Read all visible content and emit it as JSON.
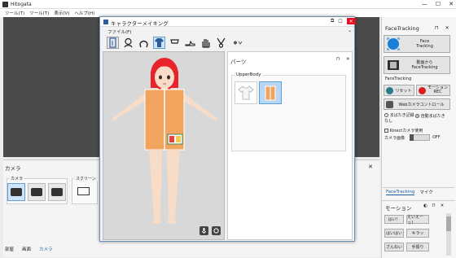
{
  "app": {
    "title": "Hitogata"
  },
  "window_controls": [
    "—",
    "☐",
    "✕"
  ],
  "menu": [
    "ツール(T)",
    "ツール(T)",
    "表示(V)",
    "ヘルプ(H)"
  ],
  "camera_panel": {
    "title": "カメラ",
    "close": "✕",
    "camera_group_label": "カメラ",
    "screen_group_label": "スクリーン",
    "tabs": [
      "部屋",
      "画面",
      "カメラ"
    ],
    "active_tab": "カメラ"
  },
  "dialog": {
    "title": "キャラクターメイキング",
    "controls": [
      "⧉",
      "☐"
    ],
    "close": "✕",
    "menu_label": "ファイル(F)",
    "chevron": "⌄",
    "toolbar_tools": [
      "body-icon",
      "head-icon",
      "hair-icon",
      "upper-body-icon",
      "lower-body-icon",
      "shoes-icon",
      "hand-icon",
      "accessory-icon",
      "more-icon"
    ],
    "active_tool": "upper-body-icon"
  },
  "parts_panel": {
    "title": "パーツ",
    "controls": "⊓ ✕",
    "group_label": "UpperBody",
    "items": [
      {
        "name": "white-shirt",
        "selected": false
      },
      {
        "name": "orange-top",
        "selected": true
      }
    ]
  },
  "face_tracking": {
    "title": "FaceTracking",
    "controls": "⊓ ✕",
    "face_tracking_button": "Face\nTracking",
    "video_button": "動画から\nFaceTracking",
    "section_label": "FaceTracking",
    "reset_button": "リセット",
    "motion_rec_button": "モーション\nREC",
    "webcam_control_button": "Webカメラコントロール",
    "radio_options": [
      {
        "label": "まばたき記録なし",
        "checked": false
      },
      {
        "label": "自動まばたき",
        "checked": true
      }
    ],
    "kinect_checkbox": "Kinectカメラ使用",
    "camera_display_label": "カメラ画像",
    "camera_display_state": "OFF",
    "tabs": [
      "FaceTracking",
      "マイク"
    ],
    "active_tab": "FaceTracking"
  },
  "motion_panel": {
    "title": "モーション",
    "controls": "◐ ⊓ ✕",
    "buttons": [
      "はい！",
      "えいえーっ！",
      "はいはい",
      "キラッ",
      "ざんねい",
      "手振り"
    ]
  },
  "colors": {
    "accent": "#1a5fa0",
    "close_red": "#e81123",
    "character_hair": "#e8242a",
    "character_top": "#f2a35e"
  }
}
